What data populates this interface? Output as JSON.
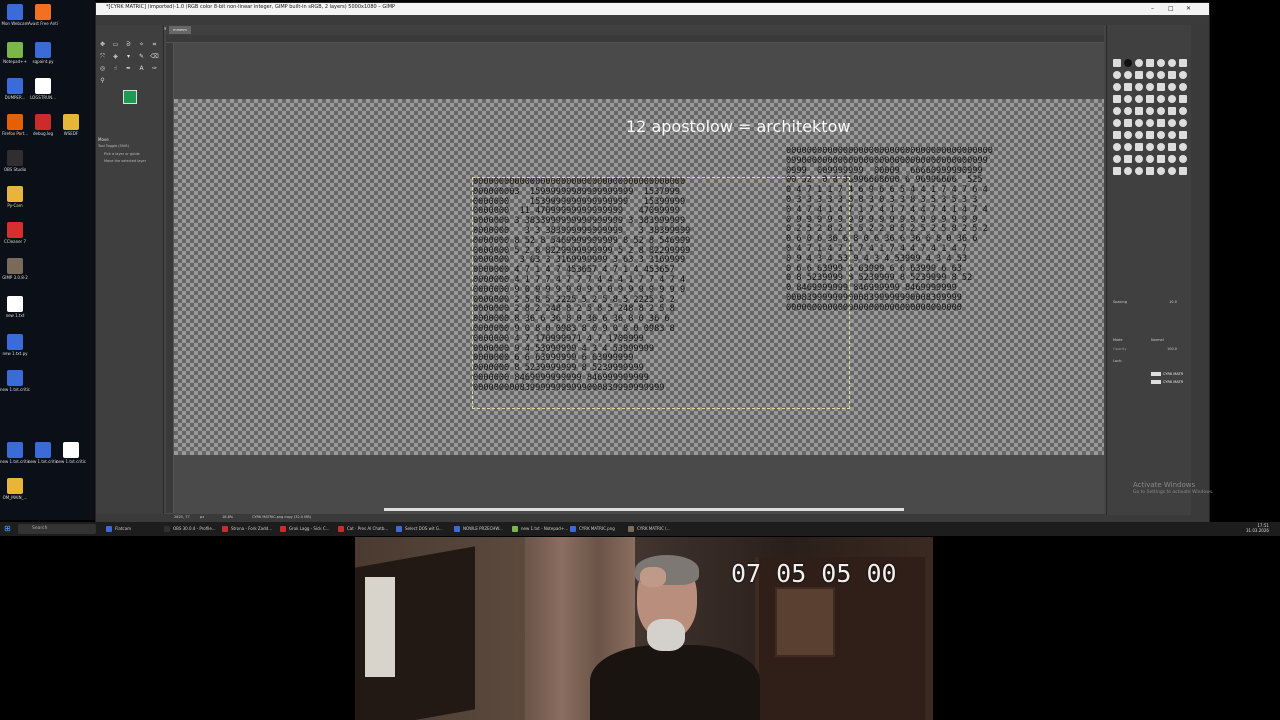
{
  "desktop": {
    "icons": [
      {
        "label": "Mon Webcam",
        "color": "#3a6bd9"
      },
      {
        "label": "Avast Free Antivirus",
        "color": "#f37021"
      },
      {
        "label": "Notepad++",
        "color": "#7ab648"
      },
      {
        "label": "sqpaint.py",
        "color": "#3a6bd9"
      },
      {
        "label": "DUMPER...",
        "color": "#3a6bd9"
      },
      {
        "label": "LOGSTRUN...",
        "color": "#ffffff"
      },
      {
        "label": "Firefox Port...",
        "color": "#e66000"
      },
      {
        "label": "debug.log",
        "color": "#cc2b2b"
      },
      {
        "label": "WSEDF",
        "color": "#e8b53b"
      },
      {
        "label": "OBS Studio",
        "color": "#302e31"
      },
      {
        "label": "Py-Cam",
        "color": "#e8b53b"
      },
      {
        "label": "CCleaner 7",
        "color": "#d92e2e"
      },
      {
        "label": "GIMP 3.0.8-2",
        "color": "#7a6a5a"
      },
      {
        "label": "new 1.txt",
        "color": "#ffffff"
      },
      {
        "label": "new 1.txt.py",
        "color": "#3a6bd9"
      },
      {
        "label": "new 1.txt.critical...",
        "color": "#3a6bd9"
      },
      {
        "label": "new 1.txt.critical...",
        "color": "#3a6bd9"
      },
      {
        "label": "new 1.txt.critical...",
        "color": "#3a6bd9"
      },
      {
        "label": "new 1.txt.critical...",
        "color": "#ffffff"
      },
      {
        "label": "OM_MAIN_...",
        "color": "#e8b53b"
      }
    ]
  },
  "gimp": {
    "title": "*[CYRK MATRIC] (imported)-1.0 (RGB color 8-bit non-linear integer, GIMP built-in sRGB, 2 layers) 5000x1080 – GIMP",
    "menu": [
      "File",
      "Edit",
      "Select",
      "View",
      "Image",
      "Layer",
      "Colors",
      "Tools",
      "Filters",
      "Windows",
      "Help"
    ],
    "tool_options": {
      "title": "Move",
      "toggle": "Tool Toggle (Shift)",
      "opt1": "Pick a layer or guide",
      "opt2": "Move the selected layer"
    },
    "canvas_text": "12 apostolow = architektow",
    "matrix_a": [
      "00000000000000000000000000000000000000000",
      "000000003  15999999989999999999  1537999",
      "0000000    1539999999999999999   15399999",
      "0000000  11 47099999999999999   47099999",
      "0000000 3 3833999999999999999 3 383999999",
      "0000000   3 3 383999999999999   3 38399999",
      "0000000 8 52 8 5469999999999 8 52 8 546999",
      "0000000 5 2 8 8229999999999 5 2 8 82299999",
      "0000000  3 63 3 3169999999 3 63 3 3169999",
      "0000000 4 7 1 4 7 453657 4 7 1 4 453657",
      "0000000 4 1 7 7 4 7 7 7 4 4 4 1 7 7 4 7 4",
      "0000000 9 0 9 9 9 9 9 9 9 0 9 9 9 9 9 9 9",
      "0000000 2 5 8 5 2225 5 2 5 8 5 2225 5 2",
      "0000000 2 8 2 248 8 2 5 8 5 248 8 2 5 8",
      "0000000 8 36 6 36 8 0 36 6 36 8 0 36 6",
      "0000000 9 0 8 0 0983 8 0 9 0 8 0 0983 8",
      "0000000 4 7 170999971 4 7 1709999",
      "0000000 9 4 53999999 4 3 4 53999999",
      "0000000 6 6 63999999 6 63999999",
      "0000000 8 5239999999 8 5239999999",
      "0000000 8469999999999 846999999999",
      "0000000008399999999999000839999999999"
    ],
    "matrix_b": [
      "0000000000000000000000000000000000000000",
      "099000000000000000000000000000000000099",
      "0999  009999999  00009  66660999990999",
      "00 52  0 8 96996668600 6 96996666  525",
      "0 4 7 1 1 7 4 6 9 6 6 5 4 4 1 7 4 7 6 4",
      "0 3 3 3 3 3 8 8 3 0 3 3 8 3 5 3 5 3 3",
      "0 4 7 4 1 4 7 1 7 4 1 7 4 4 7 4 1 4 7 4",
      "0 9 9 9 9 9 9 9 9 9 9 9 9 9 9 9 9 9 9",
      "0 2 5 2 8 2 5 5 2 2 8 5 2 5 2 5 8 2 5 2",
      "0 6 0 6 36 6 8 0 6 36 6 36 6 8 0 36 6",
      "0 4 7 1 4 7 1 7 4 1 7 4 4 7 4 1 4 7",
      "0 9 4 3 4 53 9 4 3 4 53999 4 3 4 53",
      "0 6 6 63999 6 63999 6 6 63999 6 63",
      "0 8 5239999 8 5239999 8 5239999 8 52",
      "0 8469999999 846999999 8469999999",
      "0008399999990008399999990008399999",
      "0000000000000000000000000000000000"
    ],
    "tab_label": "mmmm",
    "status": {
      "coords": "2825, 77",
      "unit": "px",
      "zoom": "18.8%",
      "layer_info": "CYRK MATRIC.png copy (32.0 MB)"
    },
    "dock": {
      "brush_label": "Spacing",
      "spacing_value": "10.0",
      "mode_label": "Mode",
      "mode_value": "Normal",
      "opacity_label": "Opacity",
      "opacity_value": "100.0",
      "lock_label": "Lock:",
      "layers": [
        "CYRK MATR",
        "CYRK MATR"
      ]
    },
    "activate_title": "Activate Windows",
    "activate_sub": "Go to Settings to activate Windows."
  },
  "taskbar": {
    "search_placeholder": "Search",
    "items": [
      {
        "label": "Flatcam",
        "color": "#3a6bd9"
      },
      {
        "label": "OBS 30.0.4 - Profile...",
        "color": "#302e31"
      },
      {
        "label": "Strona - Fork Zadd...",
        "color": "#cc2b2b"
      },
      {
        "label": "Grok Lagg - Sick C...",
        "color": "#cc2b2b"
      },
      {
        "label": "Cat · Pres AI Chatb...",
        "color": "#cc2b2b"
      },
      {
        "label": "Select DOS wit G...",
        "color": "#3a6bd9"
      },
      {
        "label": "NOWLE PRZECHW...",
        "color": "#3a6bd9"
      },
      {
        "label": "new 1.txt - Notepad+...",
        "color": "#7ab648"
      },
      {
        "label": "CYRK MATRIC.png",
        "color": "#3a6bd9"
      },
      {
        "label": "CYRK MATRIC (...",
        "color": "#7a6a5a"
      }
    ],
    "time": "17:51",
    "date": "31.03.2026"
  },
  "webcam": {
    "timecode": "07 05 05 00"
  }
}
